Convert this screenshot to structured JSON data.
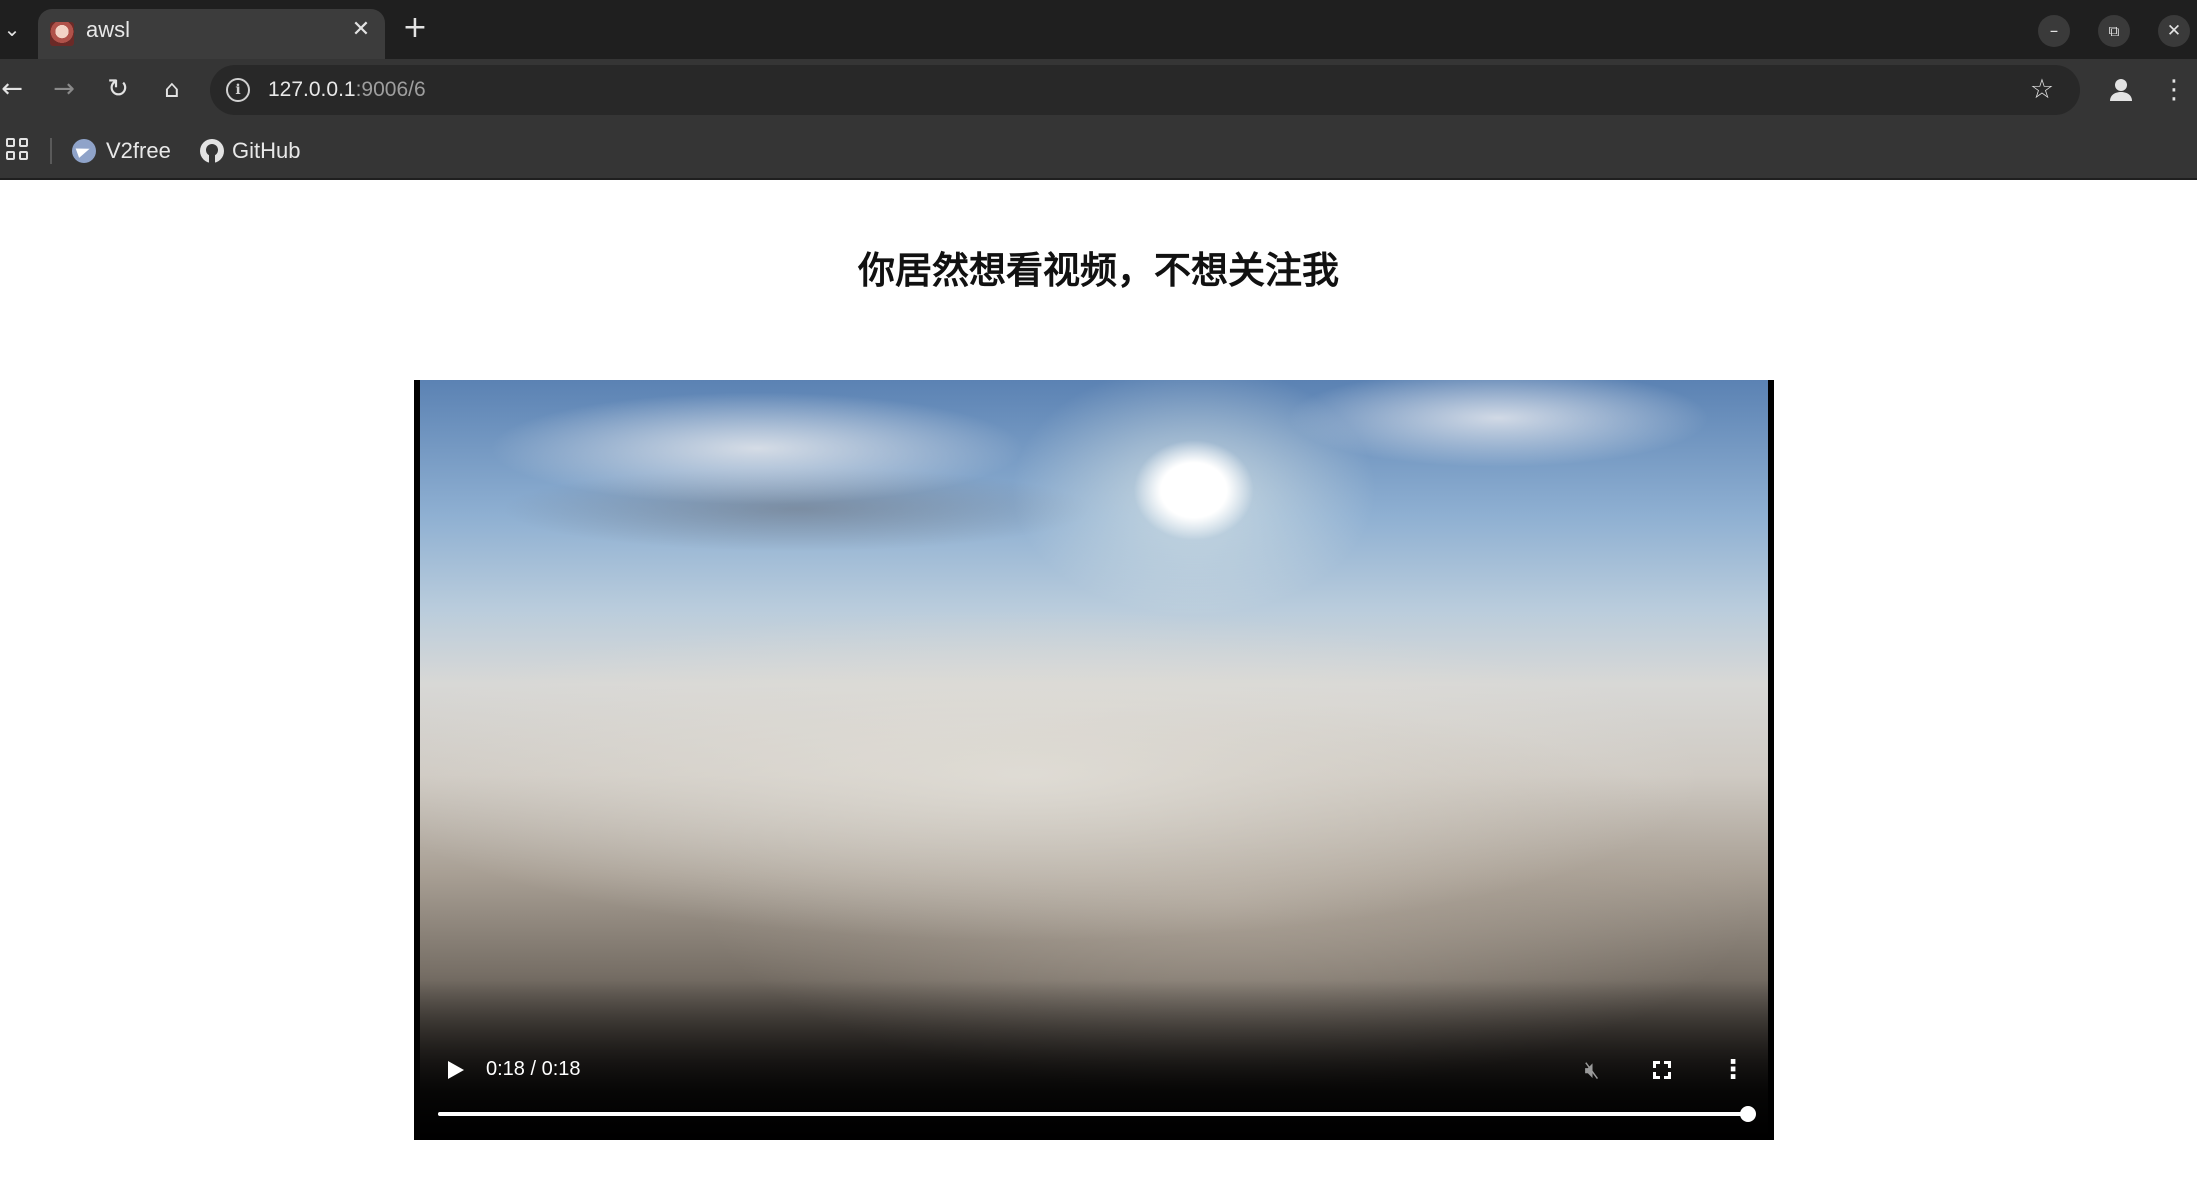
{
  "browser": {
    "tab": {
      "title": "awsl"
    },
    "address": {
      "host": "127.0.0.1",
      "path": ":9006/6"
    },
    "bookmarks": [
      {
        "label": "V2free",
        "icon": "telegram-icon"
      },
      {
        "label": "GitHub",
        "icon": "github-icon"
      }
    ],
    "window_controls": {
      "minimize": "–",
      "restore": "⧉",
      "close": "✕"
    }
  },
  "page": {
    "title": "你居然想看视频，不想关注我"
  },
  "video": {
    "time_display": "0:18 / 0:18",
    "current_time": "0:18",
    "duration": "0:18",
    "progress_fraction": 1.0,
    "muted": true
  }
}
